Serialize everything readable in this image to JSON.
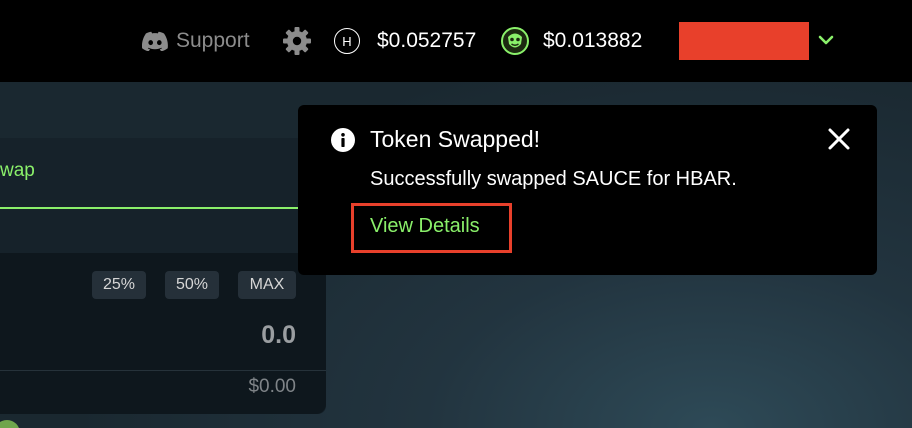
{
  "header": {
    "support_label": "Support",
    "discord_icon": "discord-icon",
    "settings_icon": "gear-icon",
    "prices": [
      {
        "icon": "hbar-icon",
        "icon_glyph": "H",
        "value": "$0.052757"
      },
      {
        "icon": "sauce-icon",
        "value": "$0.013882"
      }
    ],
    "account": {
      "redacted_color": "#e8402b",
      "dropdown_icon": "chevron-down-icon"
    }
  },
  "swap": {
    "tab_label": "wap",
    "percent_buttons": [
      "25%",
      "50%",
      "MAX"
    ],
    "amount_value": "0.0",
    "usd_value": "$0.00"
  },
  "toast": {
    "icon": "info-icon",
    "title": "Token Swapped!",
    "message": "Successfully swapped SAUCE for HBAR.",
    "link_label": "View Details",
    "close_icon": "close-icon",
    "highlight_color": "#e8402b"
  },
  "colors": {
    "accent_green": "#8af06a",
    "topbar_bg": "#000000",
    "toast_bg": "#000000"
  }
}
